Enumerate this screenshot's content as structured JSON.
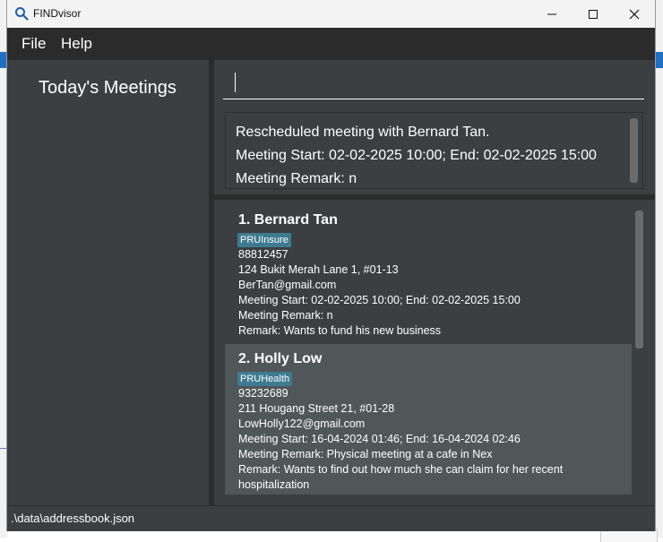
{
  "window": {
    "title": "FINDvisor",
    "icon": "search-icon"
  },
  "menu": {
    "file": "File",
    "help": "Help"
  },
  "sidebar": {
    "title": "Today's Meetings"
  },
  "command": {
    "value": "",
    "placeholder": ""
  },
  "result": {
    "line1": "Rescheduled meeting with Bernard Tan.",
    "line2": "Meeting Start: 02-02-2025 10:00; End: 02-02-2025 15:00",
    "line3": "Meeting Remark: n"
  },
  "persons": [
    {
      "name": "1.  Bernard Tan",
      "tag": "PRUInsure",
      "phone": "88812457",
      "address": "124 Bukit Merah Lane 1, #01-13",
      "email": "BerTan@gmail.com",
      "meeting": "Meeting Start: 02-02-2025 10:00; End: 02-02-2025 15:00",
      "meeting_remark": "Meeting Remark: n",
      "remark": "Remark: Wants to fund his new business"
    },
    {
      "name": "2.  Holly Low",
      "tag": "PRUHealth",
      "phone": "93232689",
      "address": "211 Hougang Street 21, #01-28",
      "email": "LowHolly122@gmail.com",
      "meeting": "Meeting Start: 16-04-2024 01:46; End: 16-04-2024 02:46",
      "meeting_remark": "Meeting Remark: Physical meeting at a cafe in Nex",
      "remark": "Remark: Wants to find out how much she can claim for her recent",
      "remark_cont": "hospitalization"
    }
  ],
  "status": {
    "path": ".\\data\\addressbook.json"
  },
  "colors": {
    "panel": "#3c3f41",
    "dark": "#2b2b2b",
    "alt_row": "#515658",
    "tag": "#3e7b91"
  }
}
